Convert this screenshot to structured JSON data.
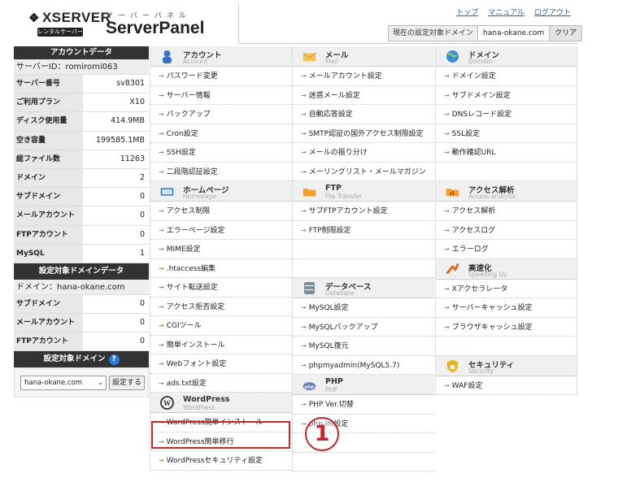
{
  "header": {
    "logo_text": "XSERVER",
    "logo_badge": "レンタルサーバー",
    "subtitle": "サーバーパネル",
    "title": "ServerPanel",
    "links": [
      "トップ",
      "マニュアル",
      "ログアウト"
    ],
    "domain_label": "現在の設定対象ドメイン",
    "domain_value": "hana-okane.com",
    "clear_button": "クリア"
  },
  "sidebar": {
    "account_head": "アカウントデータ",
    "server_id": "サーバーID：romiromi063",
    "account_rows": [
      {
        "k": "サーバー番号",
        "v": "sv8301"
      },
      {
        "k": "ご利用プラン",
        "v": "X10"
      },
      {
        "k": "ディスク使用量",
        "v": "414.9MB"
      },
      {
        "k": "空き容量",
        "v": "199585.1MB"
      },
      {
        "k": "総ファイル数",
        "v": "11263"
      },
      {
        "k": "ドメイン",
        "v": "2"
      },
      {
        "k": "サブドメイン",
        "v": "0"
      },
      {
        "k": "メールアカウント",
        "v": "0"
      },
      {
        "k": "FTPアカウント",
        "v": "0"
      },
      {
        "k": "MySQL",
        "v": "1"
      }
    ],
    "domain_head": "設定対象ドメインデータ",
    "domain_line": "ドメイン：hana-okane.com",
    "domain_rows": [
      {
        "k": "サブドメイン",
        "v": "0"
      },
      {
        "k": "メールアカウント",
        "v": "0"
      },
      {
        "k": "FTPアカウント",
        "v": "0"
      }
    ],
    "select_head": "設定対象ドメイン",
    "help": "?",
    "select_value": "hana-okane.com",
    "select_button": "設定する"
  },
  "columns": {
    "col1": {
      "account": {
        "title": "アカウント",
        "sub": "Account",
        "items": [
          "パスワード変更",
          "サーバー情報",
          "バックアップ",
          "Cron設定",
          "SSH設定",
          "二段階認証設定"
        ]
      },
      "homepage": {
        "title": "ホームページ",
        "sub": "Homepage",
        "items": [
          "アクセス制限",
          "エラーページ設定",
          "MIME設定",
          ".htaccess編集",
          "サイト転送設定",
          "アクセス拒否設定",
          "CGIツール",
          "簡単インストール",
          "Webフォント設定",
          "ads.txt設定"
        ]
      },
      "wordpress": {
        "title": "WordPress",
        "sub": "WordPress",
        "items": [
          "WordPress簡単インストール",
          "WordPress簡単移行",
          "WordPressセキュリティ設定"
        ]
      }
    },
    "col2": {
      "mail": {
        "title": "メール",
        "sub": "Mail",
        "items": [
          "メールアカウント設定",
          "迷惑メール設定",
          "自動応答設定",
          "SMTP認証の国外アクセス制限設定",
          "メールの振り分け",
          "メーリングリスト・メールマガジン"
        ]
      },
      "ftp": {
        "title": "FTP",
        "sub": "File Transfer",
        "items": [
          "サブFTPアカウント設定",
          "FTP制限設定"
        ]
      },
      "database": {
        "title": "データベース",
        "sub": "Database",
        "items": [
          "MySQL設定",
          "MySQLバックアップ",
          "MySQL復元",
          "phpmyadmin(MySQL5.7)"
        ]
      },
      "php": {
        "title": "PHP",
        "sub": "PHP",
        "items": [
          "PHP Ver.切替",
          "php.ini設定"
        ]
      }
    },
    "col3": {
      "domain": {
        "title": "ドメイン",
        "sub": "Domain",
        "items": [
          "ドメイン設定",
          "サブドメイン設定",
          "DNSレコード設定",
          "SSL設定",
          "動作確認URL"
        ]
      },
      "access": {
        "title": "アクセス解析",
        "sub": "Access analysis",
        "items": [
          "アクセス解析",
          "アクセスログ",
          "エラーログ"
        ]
      },
      "speed": {
        "title": "高速化",
        "sub": "Speeding Up",
        "items": [
          "Xアクセラレータ",
          "サーバーキャッシュ設定",
          "ブラウザキャッシュ設定"
        ]
      },
      "security": {
        "title": "セキュリティ",
        "sub": "Security",
        "items": [
          "WAF設定"
        ]
      }
    }
  },
  "annotation": {
    "number": "1"
  },
  "icons": {
    "account": "person-icon",
    "homepage": "monitor-icon",
    "wordpress": "wordpress-icon",
    "mail": "envelope-icon",
    "ftp": "folder-icon",
    "database": "database-icon",
    "php": "php-icon",
    "domain": "globe-icon",
    "access": "chart-icon",
    "speed": "arrow-up-icon",
    "security": "lock-icon"
  },
  "colors": {
    "highlight": "#c4262a",
    "chevron": "#4a8f3a",
    "link": "#2a5db0"
  }
}
